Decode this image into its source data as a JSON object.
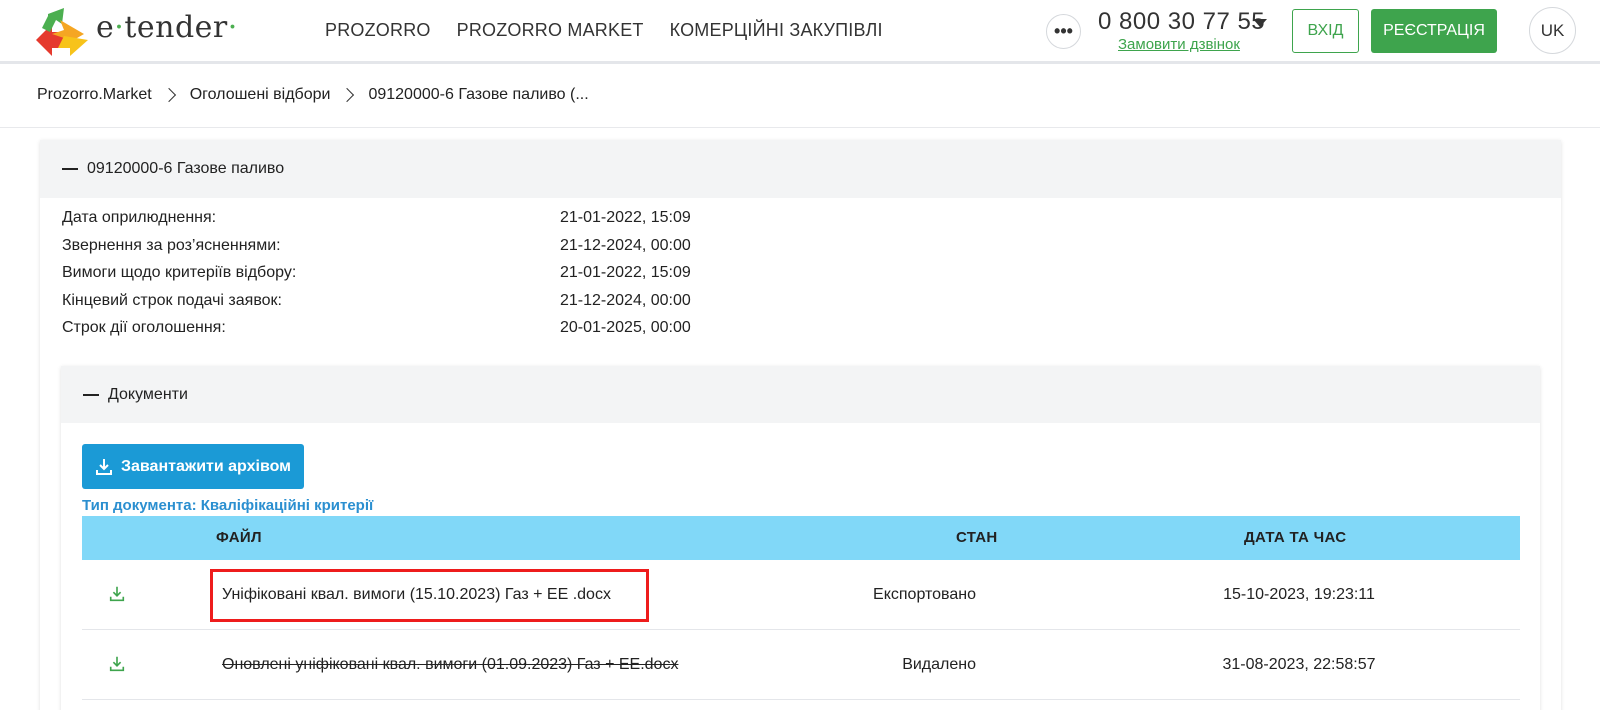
{
  "header": {
    "logo_text_1": "e",
    "logo_text_dot": "·",
    "logo_text_2": "tender",
    "nav": [
      "PROZORRO",
      "PROZORRO MARKET",
      "КОМЕРЦІЙНІ ЗАКУПІВЛІ"
    ],
    "more": "•••",
    "phone": "0 800 30 77 55",
    "callback": "Замовити дзвінок",
    "login": "ВХІД",
    "register": "РЕЄСТРАЦІЯ",
    "lang": "UK",
    "colors": {
      "green": "#3ea44d",
      "accent_blue": "#1b9ad6"
    }
  },
  "breadcrumb": [
    "Prozorro.Market",
    "Оголошені відбори",
    "09120000-6 Газове паливо (..."
  ],
  "card": {
    "title": "09120000-6 Газове паливо",
    "info": [
      {
        "label": "Дата оприлюднення:",
        "value": "21-01-2022, 15:09"
      },
      {
        "label": "Звернення за роз’ясненнями:",
        "value": "21-12-2024, 00:00"
      },
      {
        "label": "Вимоги щодо критеріїв відбору:",
        "value": "21-01-2022, 15:09"
      },
      {
        "label": "Кінцевий строк подачі заявок:",
        "value": "21-12-2024, 00:00"
      },
      {
        "label": "Строк дії оголошення:",
        "value": "20-01-2025, 00:00"
      }
    ]
  },
  "documents": {
    "title": "Документи",
    "archive_button": "Завантажити архівом",
    "doc_type": "Тип документа: Кваліфікаційні критерії",
    "columns": [
      "ФАЙЛ",
      "СТАН",
      "ДАТА ТА ЧАС"
    ],
    "rows": [
      {
        "file": "Уніфіковані квал. вимоги (15.10.2023) Газ + ЕЕ .docx",
        "state": "Експортовано",
        "datetime": "15-10-2023, 19:23:11"
      },
      {
        "file": "Оновлені уніфіковані квал. вимоги (01.09.2023) Газ + ЕЕ.docx",
        "state": "Видалено",
        "datetime": "31-08-2023, 22:58:57"
      }
    ]
  }
}
